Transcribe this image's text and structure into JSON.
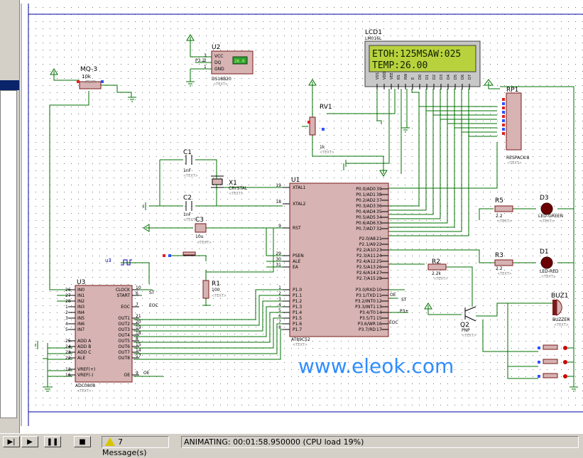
{
  "schematic": {
    "watermark": "www.eleok.com",
    "lcd": {
      "ref": "LCD1",
      "model": "LM016L",
      "line1": "ETOH:125MSAW:025",
      "line2": "TEMP:26.00",
      "pins": [
        "VSS",
        "VDD",
        "VEE",
        "RS",
        "RW",
        "E",
        "D0",
        "D1",
        "D2",
        "D3",
        "D4",
        "D5",
        "D6",
        "D7"
      ]
    },
    "u2": {
      "ref": "U2",
      "name": "DS18B20",
      "pins": [
        "VCC",
        "DQ",
        "GND"
      ],
      "pin_nums": [
        "3",
        "2",
        "1"
      ],
      "net": "P3.2",
      "reading": "26.0"
    },
    "mq3": {
      "ref": "MQ-3",
      "value": "10k"
    },
    "rv1": {
      "ref": "RV1",
      "value": "1k"
    },
    "rp1": {
      "ref": "RP1",
      "model": "RESPACK-8"
    },
    "c1": {
      "ref": "C1",
      "value": "1nF"
    },
    "c2": {
      "ref": "C2",
      "value": "1nF"
    },
    "c3": {
      "ref": "C3",
      "value": "10u"
    },
    "x1": {
      "ref": "X1",
      "model": "CRYSTAL"
    },
    "r1": {
      "ref": "R1",
      "value": "100"
    },
    "r2": {
      "ref": "R2",
      "value": "2.2k"
    },
    "r3": {
      "ref": "R3",
      "value": "2.2"
    },
    "r5": {
      "ref": "R5",
      "value": "2.2"
    },
    "d1": {
      "ref": "D1",
      "model": "LED-RED"
    },
    "d3": {
      "ref": "D3",
      "model": "LED-GREEN"
    },
    "q2": {
      "ref": "Q2",
      "model": "PNP"
    },
    "buz1": {
      "ref": "BUZ1",
      "model": "BUZZER"
    },
    "u3src": {
      "ref": "u3"
    },
    "text_placeholder": "<TEXT>",
    "u1": {
      "ref": "U1",
      "model": "AT89C52",
      "left_pins": [
        {
          "num": "19",
          "name": "XTAL1"
        },
        {
          "num": "18",
          "name": "XTAL2"
        },
        {
          "num": "9",
          "name": "RST"
        },
        {
          "num": "29",
          "name": "PSEN"
        },
        {
          "num": "30",
          "name": "ALE"
        },
        {
          "num": "31",
          "name": "EA"
        },
        {
          "num": "1",
          "name": "P1.0"
        },
        {
          "num": "2",
          "name": "P1.1"
        },
        {
          "num": "3",
          "name": "P1.2"
        },
        {
          "num": "4",
          "name": "P1.3"
        },
        {
          "num": "5",
          "name": "P1.4"
        },
        {
          "num": "6",
          "name": "P1.5"
        },
        {
          "num": "7",
          "name": "P1.6"
        },
        {
          "num": "8",
          "name": "P1.7"
        }
      ],
      "right_pins": [
        {
          "num": "39",
          "name": "P0.0/AD0"
        },
        {
          "num": "38",
          "name": "P0.1/AD1"
        },
        {
          "num": "37",
          "name": "P0.2/AD2"
        },
        {
          "num": "36",
          "name": "P0.3/AD3"
        },
        {
          "num": "35",
          "name": "P0.4/AD4"
        },
        {
          "num": "34",
          "name": "P0.5/AD5"
        },
        {
          "num": "33",
          "name": "P0.6/AD6"
        },
        {
          "num": "32",
          "name": "P0.7/AD7"
        },
        {
          "num": "21",
          "name": "P2.0/A8"
        },
        {
          "num": "22",
          "name": "P2.1/A9"
        },
        {
          "num": "23",
          "name": "P2.2/A10"
        },
        {
          "num": "24",
          "name": "P2.3/A11"
        },
        {
          "num": "25",
          "name": "P2.4/A12"
        },
        {
          "num": "26",
          "name": "P2.5/A13"
        },
        {
          "num": "27",
          "name": "P2.6/A14"
        },
        {
          "num": "28",
          "name": "P2.7/A15"
        },
        {
          "num": "10",
          "name": "P3.0/RXD"
        },
        {
          "num": "11",
          "name": "P3.1/TXD"
        },
        {
          "num": "12",
          "name": "P3.2/INT0"
        },
        {
          "num": "13",
          "name": "P3.3/INT1"
        },
        {
          "num": "14",
          "name": "P3.4/T0"
        },
        {
          "num": "15",
          "name": "P3.5/T1"
        },
        {
          "num": "16",
          "name": "P3.6/WR"
        },
        {
          "num": "17",
          "name": "P3.7/RD"
        }
      ],
      "net_labels": [
        "ST",
        "P3+",
        "EOC",
        "OE"
      ]
    },
    "u3": {
      "ref": "U3",
      "model": "ADC0808",
      "left_pins": [
        {
          "num": "26",
          "name": "IN0"
        },
        {
          "num": "27",
          "name": "IN1"
        },
        {
          "num": "28",
          "name": "IN2"
        },
        {
          "num": "1",
          "name": "IN3"
        },
        {
          "num": "2",
          "name": "IN4"
        },
        {
          "num": "3",
          "name": "IN5"
        },
        {
          "num": "4",
          "name": "IN6"
        },
        {
          "num": "5",
          "name": "IN7"
        },
        {
          "num": "25",
          "name": "ADD A"
        },
        {
          "num": "24",
          "name": "ADD B"
        },
        {
          "num": "23",
          "name": "ADD C"
        },
        {
          "num": "22",
          "name": "ALE"
        },
        {
          "num": "12",
          "name": "VREF(+)"
        },
        {
          "num": "16",
          "name": "VREF(-)"
        }
      ],
      "right_pins": [
        {
          "num": "10",
          "name": "CLOCK"
        },
        {
          "num": "6",
          "name": "START"
        },
        {
          "num": "7",
          "name": "EOC"
        },
        {
          "num": "21",
          "name": "OUT1"
        },
        {
          "num": "20",
          "name": "OUT2"
        },
        {
          "num": "19",
          "name": "OUT3"
        },
        {
          "num": "18",
          "name": "OUT4"
        },
        {
          "num": "8",
          "name": "OUT5"
        },
        {
          "num": "15",
          "name": "OUT6"
        },
        {
          "num": "14",
          "name": "OUT7"
        },
        {
          "num": "17",
          "name": "OUT8"
        },
        {
          "num": "9",
          "name": "OE"
        }
      ],
      "net_labels": [
        "ST",
        "EOC",
        "OE"
      ]
    }
  },
  "statusbar": {
    "messages": "7 Message(s)",
    "status": "ANIMATING: 00:01:58.950000 (CPU load 19%)"
  },
  "colors": {
    "wire": "#007000",
    "chip": "#d7b3b3",
    "chip_border": "#7a1a1a",
    "lcd": "#b8d23e",
    "led": "#8b0000",
    "text": "#000080",
    "watermark": "#2f8cff"
  }
}
